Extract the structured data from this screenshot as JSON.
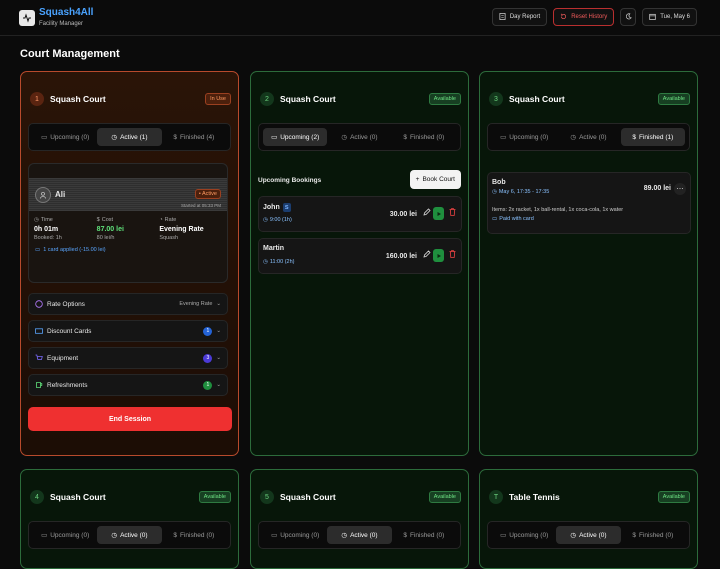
{
  "app": {
    "name": "Squash4All",
    "subtitle": "Facility Manager"
  },
  "topbar": {
    "day_report": "Day Report",
    "reset_history": "Reset History",
    "date": "Tue, May 6"
  },
  "page_title": "Court Management",
  "cards": [
    {
      "num": "1",
      "name": "Squash Court",
      "status": "In Use",
      "tabs": [
        "Upcoming (0)",
        "Active (1)",
        "Finished (4)"
      ],
      "session": {
        "player": "Ali",
        "status": "Active",
        "started": "Started at 05:33 PM",
        "time_label": "Time",
        "time_value": "0h 01m",
        "time_sub": "Booked: 1h",
        "cost_label": "Cost",
        "cost_value": "87.00 lei",
        "cost_sub": "80 lei/h",
        "rate_label": "Rate",
        "rate_value": "Evening Rate",
        "rate_sub": "Squash",
        "card_applied": "1 card applied (-15.00 lei)"
      },
      "accordions": [
        {
          "label": "Rate Options",
          "value": "Evening Rate"
        },
        {
          "label": "Discount Cards",
          "count": "1"
        },
        {
          "label": "Equipment",
          "count": "3"
        },
        {
          "label": "Refreshments",
          "count": "1"
        }
      ],
      "end_session": "End Session"
    },
    {
      "num": "2",
      "name": "Squash Court",
      "status": "Available",
      "tabs": [
        "Upcoming (2)",
        "Active (0)",
        "Finished (0)"
      ],
      "section": "Upcoming Bookings",
      "book_court": "Book Court",
      "bookings": [
        {
          "name": "John",
          "badge": "S",
          "time": "9:00 (1h)",
          "price": "30.00 lei"
        },
        {
          "name": "Martin",
          "time": "11:00 (2h)",
          "price": "160.00 lei"
        }
      ]
    },
    {
      "num": "3",
      "name": "Squash Court",
      "status": "Available",
      "tabs": [
        "Upcoming (0)",
        "Active (0)",
        "Finished (1)"
      ],
      "finished": {
        "name": "Bob",
        "time": "May 6, 17:35 - 17:35",
        "price": "89.00 lei",
        "items": "Items: 2x racket, 1x ball-rental, 1x coca-cola, 1x water",
        "payment": "Paid with card"
      }
    },
    {
      "num": "4",
      "name": "Squash Court",
      "status": "Available",
      "tabs": [
        "Upcoming (0)",
        "Active (0)",
        "Finished (0)"
      ]
    },
    {
      "num": "5",
      "name": "Squash Court",
      "status": "Available",
      "tabs": [
        "Upcoming (0)",
        "Active (0)",
        "Finished (0)"
      ]
    },
    {
      "num": "T",
      "name": "Table Tennis",
      "status": "Available",
      "tabs": [
        "Upcoming (0)",
        "Active (0)",
        "Finished (0)"
      ]
    }
  ],
  "colors": {
    "accent_blue": "#4aa3ff",
    "in_use": "#ff9b62",
    "available": "#6de283",
    "danger": "#ef3030"
  }
}
